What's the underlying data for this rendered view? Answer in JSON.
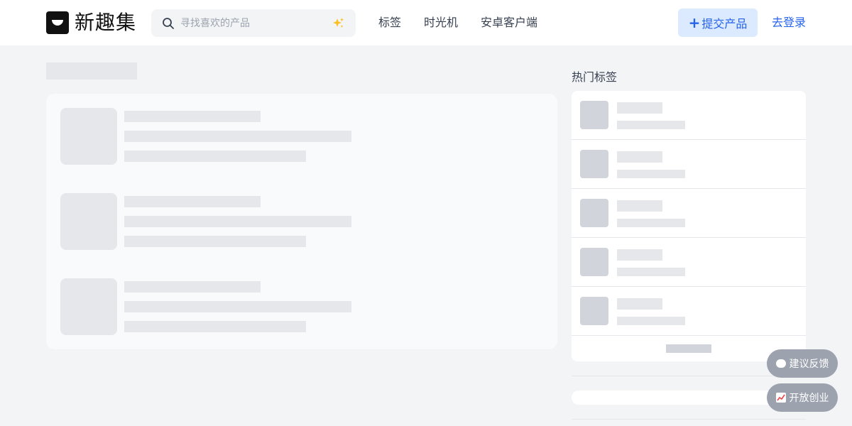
{
  "header": {
    "logo_text": "新趣集",
    "search": {
      "placeholder": "寻找喜欢的产品"
    },
    "nav": [
      "标签",
      "时光机",
      "安卓客户端"
    ],
    "submit_label": "提交产品",
    "submit_icon": "+",
    "login_label": "去登录"
  },
  "sidebar": {
    "hot_title": "热门标签"
  },
  "floating": {
    "feedback_label": "建议反馈",
    "startup_label": "开放创业"
  },
  "colors": {
    "accent": "#2563eb",
    "accent_bg": "#dbeafe",
    "skeleton": "#e5e7eb",
    "page_bg": "#f3f4f6",
    "sparkle": "#fbbf24"
  },
  "icons": [
    "logo-mark-icon",
    "search-icon",
    "sparkle-icon",
    "plus-icon",
    "chat-bubble-icon",
    "chart-up-icon"
  ]
}
